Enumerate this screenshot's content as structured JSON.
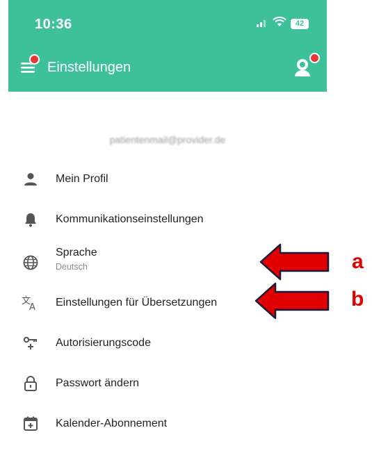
{
  "status_bar": {
    "time": "10:36",
    "battery": "42"
  },
  "app_bar": {
    "title": "Einstellungen"
  },
  "account": {
    "email": "patientenmail@provider.de"
  },
  "menu": [
    {
      "label": "Mein Profil",
      "icon": "person-icon"
    },
    {
      "label": "Kommunikationseinstellungen",
      "icon": "bell-icon"
    },
    {
      "label": "Sprache",
      "sublabel": "Deutsch",
      "icon": "globe-icon"
    },
    {
      "label": "Einstellungen für Übersetzungen",
      "icon": "translate-icon"
    },
    {
      "label": "Autorisierungscode",
      "icon": "key-icon"
    },
    {
      "label": "Passwort ändern",
      "icon": "lock-icon"
    },
    {
      "label": "Kalender-Abonnement",
      "icon": "calendar-add-icon"
    }
  ],
  "annotations": {
    "a": "a",
    "b": "b"
  },
  "colors": {
    "app_bar": "#3ec19a",
    "badge": "#e53935",
    "arrow": "#e00000"
  }
}
